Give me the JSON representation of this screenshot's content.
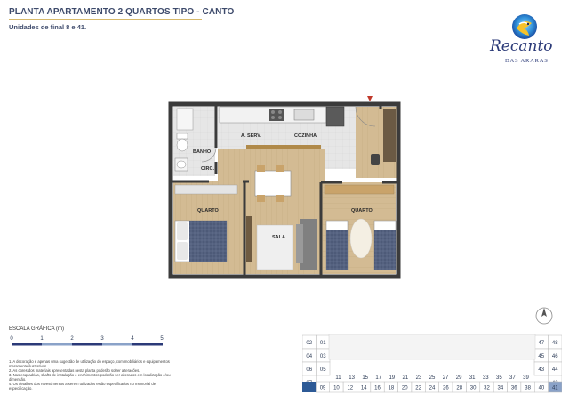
{
  "header": {
    "title": "PLANTA APARTAMENTO 2 QUARTOS TIPO - CANTO",
    "subtitle": "Unidades de final 8 e 41."
  },
  "logo": {
    "script_text": "Recanto",
    "sub_text": "DAS ARARAS",
    "icon": "macaw-logo-icon"
  },
  "plan": {
    "rooms": {
      "banho": "BANHO",
      "area_servico": "Á. SERV.",
      "cozinha": "COZINHA",
      "circ": "CIRC.",
      "quarto_1": "QUARTO",
      "quarto_2": "QUARTO",
      "sala": "SALA"
    },
    "colors": {
      "wall": "#3b3b3b",
      "floor_wood": "#d2b990",
      "floor_tile": "#e4e4e4",
      "sofa": "#808080",
      "bed_quilt": "#4d5a78"
    }
  },
  "scale": {
    "label": "ESCALA GRÁFICA (m)",
    "ticks": [
      "0",
      "1",
      "2",
      "3",
      "4",
      "5"
    ]
  },
  "notes": [
    "1. A decoração é apenas uma sugestão de utilização do espaço, com mobiliários e equipamentos meramente ilustrativos.",
    "2. As cores dos materiais apresentadas nesta planta poderão sofrer alterações.",
    "3. Nas esquadrias, shafts de instalação e enchimentos poderão ser alterados em localização e/ou dimensão.",
    "4. Os detalhes dos revestimentos a serem utilizados estão especificados no memorial de especificação."
  ],
  "compass": {
    "icon": "north-arrow-icon"
  },
  "key_plan": {
    "left_col_a": [
      "02",
      "04",
      "06",
      "07"
    ],
    "left_col_b": [
      "01",
      "03",
      "05"
    ],
    "right_col_a": [
      "47",
      "45",
      "43"
    ],
    "right_col_b": [
      "48",
      "46",
      "44",
      "42"
    ],
    "top_row": [
      "11",
      "13",
      "15",
      "17",
      "19",
      "21",
      "23",
      "25",
      "27",
      "29",
      "31",
      "33",
      "35",
      "37",
      "39"
    ],
    "bottom_row": [
      "09",
      "10",
      "12",
      "14",
      "16",
      "18",
      "20",
      "22",
      "24",
      "26",
      "28",
      "30",
      "32",
      "34",
      "36",
      "38",
      "40",
      "41"
    ],
    "highlight_color": "#2d5a96"
  }
}
